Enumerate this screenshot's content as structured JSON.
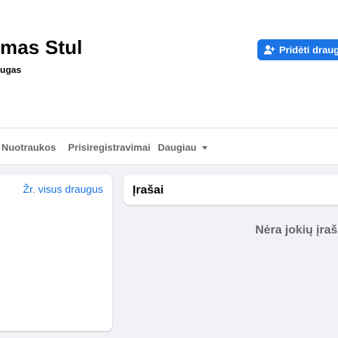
{
  "profile": {
    "name_visible": "mas Stul",
    "friends_visible": "ugas"
  },
  "actions": {
    "add_friend_label": "Pridėti draugą",
    "add_friend_icon": "add-user-icon",
    "accent": "#1b74e4"
  },
  "tabs": [
    {
      "label": "Nuotraukos"
    },
    {
      "label": "Prisiregistravimai"
    },
    {
      "label": "Daugiau",
      "icon": "caret-down-icon"
    }
  ],
  "friends_card": {
    "see_all_label": "Žr. visus draugus"
  },
  "posts": {
    "title": "Įrašai",
    "empty_text": "Nėra jokių įraš"
  }
}
